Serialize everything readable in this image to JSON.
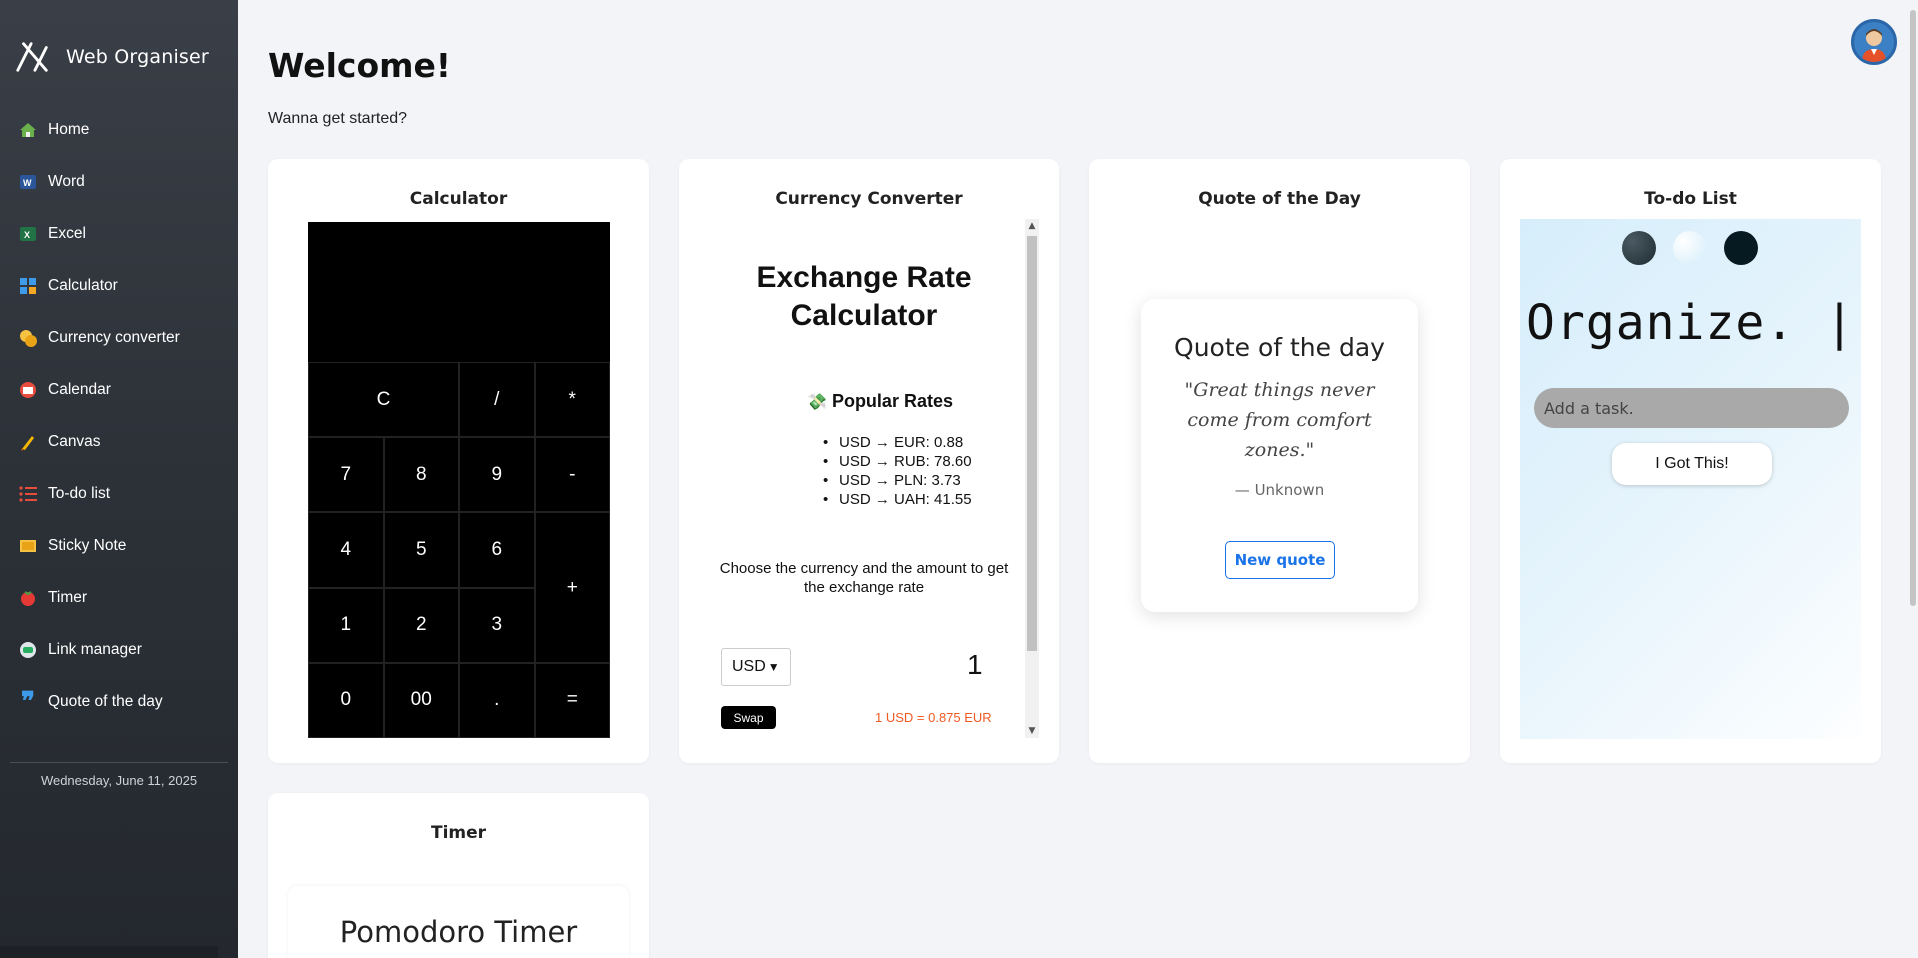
{
  "app": {
    "name": "Web Organiser"
  },
  "sidebar": {
    "items": [
      {
        "label": "Home",
        "icon": "home-icon"
      },
      {
        "label": "Word",
        "icon": "word-icon"
      },
      {
        "label": "Excel",
        "icon": "excel-icon"
      },
      {
        "label": "Calculator",
        "icon": "calculator-icon"
      },
      {
        "label": "Currency converter",
        "icon": "coins-icon"
      },
      {
        "label": "Calendar",
        "icon": "calendar-icon"
      },
      {
        "label": "Canvas",
        "icon": "brush-icon"
      },
      {
        "label": "To-do list",
        "icon": "list-icon"
      },
      {
        "label": "Sticky Note",
        "icon": "sticky-note-icon"
      },
      {
        "label": "Timer",
        "icon": "tomato-icon"
      },
      {
        "label": "Link manager",
        "icon": "link-icon"
      },
      {
        "label": "Quote of the day",
        "icon": "quote-icon"
      }
    ],
    "date": "Wednesday, June 11, 2025"
  },
  "header": {
    "title": "Welcome!",
    "subtitle": "Wanna get started?"
  },
  "calculator": {
    "title": "Calculator",
    "keys": [
      "C",
      "/",
      "*",
      "7",
      "8",
      "9",
      "-",
      "4",
      "5",
      "6",
      "+",
      "1",
      "2",
      "3",
      "0",
      "00",
      ".",
      "="
    ]
  },
  "currency": {
    "title": "Currency Converter",
    "heading": "Exchange Rate Calculator",
    "popular_title": "Popular Rates",
    "rates": [
      "USD → EUR: 0.88",
      "USD → RUB: 78.60",
      "USD → PLN: 3.73",
      "USD → UAH: 41.55"
    ],
    "instruction": "Choose the currency and the amount to get the exchange rate",
    "selected_currency": "USD",
    "amount": "1",
    "swap_label": "Swap",
    "result": "1 USD = 0.875 EUR"
  },
  "quote": {
    "title": "Quote of the Day",
    "box_title": "Quote of the day",
    "text": "\"Great things never come from comfort zones.\"",
    "author": "— Unknown",
    "button": "New quote"
  },
  "todo": {
    "title": "To-do List",
    "heading": "Organize.",
    "input_placeholder": "Add a task.",
    "button": "I Got This!",
    "theme_colors": [
      "#2f3e46",
      "#e6f4fc",
      "#061a22"
    ]
  },
  "timer": {
    "title": "Timer",
    "heading": "Pomodoro Timer"
  },
  "colors": {
    "sidebar": "#2c3138",
    "accent": "#1a73e8",
    "result": "#f05a22"
  }
}
